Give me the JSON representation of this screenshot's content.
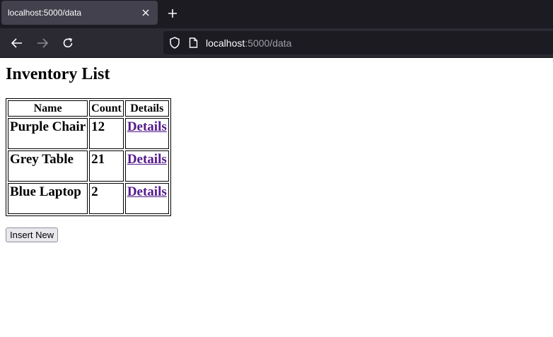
{
  "browser": {
    "tab_title": "localhost:5000/data",
    "url_host": "localhost",
    "url_rest": ":5000/data"
  },
  "page": {
    "heading": "Inventory List",
    "columns": [
      "Name",
      "Count",
      "Details"
    ],
    "rows": [
      {
        "name": "Purple Chair",
        "count": "12",
        "link": "Details"
      },
      {
        "name": "Grey Table",
        "count": "21",
        "link": "Details"
      },
      {
        "name": "Blue Laptop",
        "count": "2",
        "link": "Details"
      }
    ],
    "insert_button": "Insert New"
  },
  "colors": {
    "tabbar_bg": "#1c1b22",
    "navbar_bg": "#2b2a33",
    "link_visited": "#551a8b"
  }
}
